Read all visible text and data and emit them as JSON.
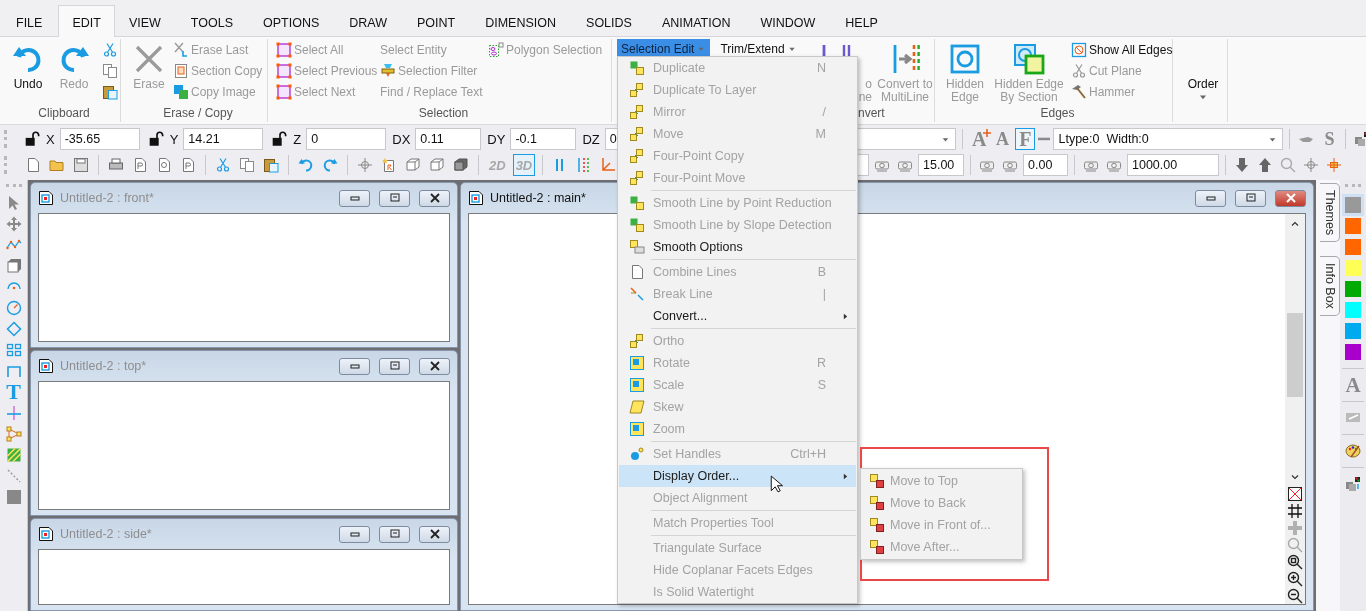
{
  "menu_tabs": [
    {
      "label": "FILE",
      "selected": false
    },
    {
      "label": "EDIT",
      "selected": true
    },
    {
      "label": "VIEW",
      "selected": false
    },
    {
      "label": "TOOLS",
      "selected": false
    },
    {
      "label": "OPTIONS",
      "selected": false
    },
    {
      "label": "DRAW",
      "selected": false
    },
    {
      "label": "POINT",
      "selected": false
    },
    {
      "label": "DIMENSION",
      "selected": false
    },
    {
      "label": "SOLIDS",
      "selected": false
    },
    {
      "label": "ANIMATION",
      "selected": false
    },
    {
      "label": "WINDOW",
      "selected": false
    },
    {
      "label": "HELP",
      "selected": false
    }
  ],
  "ribbon": {
    "groups": [
      {
        "kind": "clipboard",
        "label": "Clipboard",
        "large": [
          {
            "label": "Undo",
            "disabled": false
          },
          {
            "label": "Redo",
            "disabled": true
          }
        ]
      },
      {
        "kind": "standard",
        "label": "Erase / Copy",
        "large": [
          {
            "label": "Erase",
            "disabled": true
          }
        ],
        "columns": [
          [
            {
              "kind": "icon",
              "label": "Erase Last",
              "disabled": true
            },
            {
              "kind": "icon",
              "label": "Section Copy",
              "disabled": true
            },
            {
              "kind": "icon",
              "label": "Copy Image",
              "disabled": true
            }
          ]
        ]
      },
      {
        "kind": "standard",
        "label": "Selection",
        "columns": [
          [
            {
              "kind": "icon",
              "label": "Select All",
              "disabled": true
            },
            {
              "kind": "icon",
              "label": "Select Previous",
              "disabled": true
            },
            {
              "kind": "icon",
              "label": "Select Next",
              "disabled": true
            }
          ],
          [
            {
              "kind": "plain",
              "label": "Select Entity",
              "disabled": true
            },
            {
              "kind": "icon",
              "label": "Selection Filter",
              "disabled": true
            },
            {
              "kind": "plain",
              "label": "Find / Replace Text",
              "disabled": true
            }
          ],
          [
            {
              "kind": "icon",
              "label": "Polygon Selection",
              "disabled": true
            }
          ]
        ]
      },
      {
        "kind": "dropdowns",
        "dropdowns": [
          {
            "label": "Selection Edit",
            "selected": true
          },
          {
            "label": "Trim/Extend",
            "selected": false
          }
        ]
      },
      {
        "kind": "covered",
        "label": "nvert",
        "large": [
          {
            "label": "o ne",
            "disabled": true
          },
          {
            "label": "Convert to MultiLine",
            "disabled": true
          }
        ]
      },
      {
        "kind": "standard",
        "label": "Edges",
        "large": [
          {
            "label": "Hidden Edge",
            "disabled": true
          },
          {
            "label": "Hidden Edge By Section",
            "disabled": true
          }
        ],
        "columns": [
          [
            {
              "kind": "icon",
              "label": "Show All Edges",
              "disabled": false
            },
            {
              "kind": "icon",
              "label": "Cut Plane",
              "disabled": true
            },
            {
              "kind": "icon",
              "label": "Hammer",
              "disabled": true
            }
          ]
        ]
      },
      {
        "kind": "order",
        "large": [
          {
            "label": "Order",
            "disabled": false
          }
        ]
      }
    ]
  },
  "coordinate_bar": {
    "fields": [
      {
        "kind": "lock",
        "label": "X",
        "value": "-35.65"
      },
      {
        "kind": "lock",
        "label": "Y",
        "value": "14.21"
      },
      {
        "kind": "lock",
        "label": "Z",
        "value": "0"
      },
      {
        "kind": "plain",
        "label": "DX",
        "value": "0.11"
      },
      {
        "kind": "plain",
        "label": "DY",
        "value": "-0.1"
      },
      {
        "kind": "plain",
        "label": "DZ",
        "value": "0"
      }
    ]
  },
  "style_bar": {
    "glyph_buttons": [
      {
        "kind": "grow",
        "glyph": "A"
      },
      {
        "kind": "shrink",
        "glyph": "A"
      },
      {
        "kind": "toggle",
        "glyph": "F",
        "selected": true
      }
    ],
    "linetype": "Ltype:0  Width:0",
    "signature_glyph": "S"
  },
  "view_bar": {
    "mode_buttons": [
      {
        "label": "2D",
        "selected": false
      },
      {
        "label": "3D",
        "selected": true
      }
    ],
    "fields": [
      {
        "value": "15.00"
      },
      {
        "value": "0.00"
      },
      {
        "value": "1000.00"
      }
    ]
  },
  "left_toolbar": {
    "text_tool": "T"
  },
  "windows": [
    {
      "title": "Untitled-2 : front*",
      "active": false
    },
    {
      "title": "Untitled-2 : top*",
      "active": false
    },
    {
      "title": "Untitled-2 : side*",
      "active": false
    },
    {
      "title": "Untitled-2 : main*",
      "active": true
    }
  ],
  "side_tabs": [
    {
      "label": "Themes"
    },
    {
      "label": "Info Box"
    }
  ],
  "palette": {
    "swatches": [
      {
        "color": "#999999",
        "selected": true
      },
      {
        "color": "#ff6600",
        "selected": false
      },
      {
        "color": "#ff6600",
        "selected": false
      },
      {
        "color": "#ffff55",
        "selected": false
      },
      {
        "color": "#00aa00",
        "selected": false
      },
      {
        "color": "#00ffff",
        "selected": false
      },
      {
        "color": "#00aaee",
        "selected": false
      },
      {
        "color": "#aa00cc",
        "selected": false
      }
    ],
    "text_glyph": "A"
  },
  "dropdown_menu": {
    "items": [
      {
        "kind": "item",
        "label": "Duplicate",
        "shortcut": "N",
        "disabled": true,
        "selected": false,
        "has_submenu": false
      },
      {
        "kind": "item",
        "label": "Duplicate To Layer",
        "disabled": true,
        "selected": false,
        "has_submenu": false
      },
      {
        "kind": "item",
        "label": "Mirror",
        "shortcut": "/",
        "disabled": true,
        "selected": false,
        "has_submenu": false
      },
      {
        "kind": "item",
        "label": "Move",
        "shortcut": "M",
        "disabled": true,
        "selected": false,
        "has_submenu": false
      },
      {
        "kind": "item",
        "label": "Four-Point Copy",
        "disabled": true,
        "selected": false,
        "has_submenu": false
      },
      {
        "kind": "item",
        "label": "Four-Point Move",
        "disabled": true,
        "selected": false,
        "has_submenu": false
      },
      {
        "kind": "separator"
      },
      {
        "kind": "item",
        "label": "Smooth Line by Point Reduction",
        "disabled": true,
        "selected": false,
        "has_submenu": false
      },
      {
        "kind": "item",
        "label": "Smooth Line by Slope Detection",
        "disabled": true,
        "selected": false,
        "has_submenu": false
      },
      {
        "kind": "item",
        "label": "Smooth Options",
        "disabled": false,
        "selected": false,
        "has_submenu": false
      },
      {
        "kind": "separator"
      },
      {
        "kind": "item",
        "label": "Combine Lines",
        "shortcut": "B",
        "disabled": true,
        "selected": false,
        "has_submenu": false
      },
      {
        "kind": "item",
        "label": "Break Line",
        "shortcut": "|",
        "disabled": true,
        "selected": false,
        "has_submenu": false
      },
      {
        "kind": "item",
        "label": "Convert...",
        "disabled": false,
        "selected": false,
        "has_submenu": true
      },
      {
        "kind": "separator"
      },
      {
        "kind": "item",
        "label": "Ortho",
        "disabled": true,
        "selected": false,
        "has_submenu": false
      },
      {
        "kind": "item",
        "label": "Rotate",
        "shortcut": "R",
        "disabled": true,
        "selected": false,
        "has_submenu": false
      },
      {
        "kind": "item",
        "label": "Scale",
        "shortcut": "S",
        "disabled": true,
        "selected": false,
        "has_submenu": false
      },
      {
        "kind": "item",
        "label": "Skew",
        "disabled": true,
        "selected": false,
        "has_submenu": false
      },
      {
        "kind": "item",
        "label": "Zoom",
        "disabled": true,
        "selected": false,
        "has_submenu": false
      },
      {
        "kind": "separator"
      },
      {
        "kind": "item",
        "label": "Set Handles",
        "shortcut": "Ctrl+H",
        "disabled": true,
        "selected": false,
        "has_submenu": false
      },
      {
        "kind": "item",
        "label": "Display Order...",
        "disabled": false,
        "selected": true,
        "has_submenu": true
      },
      {
        "kind": "item",
        "label": "Object Alignment",
        "disabled": true,
        "selected": false,
        "has_submenu": false
      },
      {
        "kind": "separator"
      },
      {
        "kind": "item",
        "label": "Match Properties Tool",
        "disabled": true,
        "selected": false,
        "has_submenu": false
      },
      {
        "kind": "separator"
      },
      {
        "kind": "item",
        "label": "Triangulate Surface",
        "disabled": true,
        "selected": false,
        "has_submenu": false
      },
      {
        "kind": "item",
        "label": "Hide Coplanar Facets Edges",
        "disabled": true,
        "selected": false,
        "has_submenu": false
      },
      {
        "kind": "item",
        "label": "Is Solid Watertight",
        "disabled": true,
        "selected": false,
        "has_submenu": false
      }
    ]
  },
  "submenu": {
    "items": [
      {
        "label": "Move to Top",
        "disabled": true
      },
      {
        "label": "Move to Back",
        "disabled": true
      },
      {
        "label": "Move in Front of...",
        "disabled": true
      },
      {
        "label": "Move After...",
        "disabled": true
      }
    ]
  }
}
